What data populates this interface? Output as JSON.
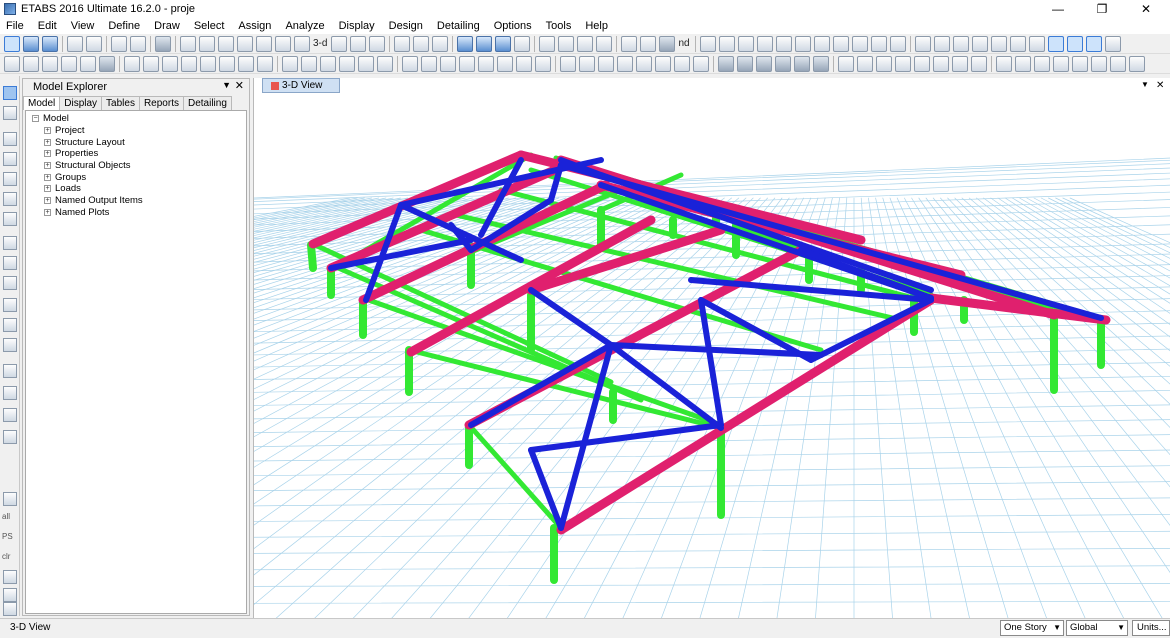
{
  "window": {
    "title": "ETABS 2016 Ultimate 16.2.0 - proje"
  },
  "menu": [
    "File",
    "Edit",
    "View",
    "Define",
    "Draw",
    "Select",
    "Assign",
    "Analyze",
    "Display",
    "Design",
    "Detailing",
    "Options",
    "Tools",
    "Help"
  ],
  "toolbar": {
    "view_3d_label": "3-d",
    "nd_label": "nd"
  },
  "explorer": {
    "title": "Model Explorer",
    "tabs": [
      "Model",
      "Display",
      "Tables",
      "Reports",
      "Detailing"
    ],
    "root": "Model",
    "items": [
      "Project",
      "Structure Layout",
      "Properties",
      "Structural Objects",
      "Groups",
      "Loads",
      "Named Output Items",
      "Named Plots"
    ]
  },
  "lefttools": {
    "all_label": "all",
    "ps_label": "PS",
    "clr_label": "clr"
  },
  "view": {
    "tab_label": "3-D View"
  },
  "status": {
    "left_text": "3-D View",
    "story_option": "One Story",
    "coord_option": "Global",
    "units_label": "Units..."
  },
  "colors": {
    "column": "#33e833",
    "beam": "#33e833",
    "girder": "#e0206e",
    "brace": "#1a22d8",
    "grid": "#a9d3ea"
  },
  "icons": [
    "app-icon",
    "minimize-icon",
    "maximize-icon",
    "close-icon",
    "pin-icon",
    "pointer-icon"
  ]
}
